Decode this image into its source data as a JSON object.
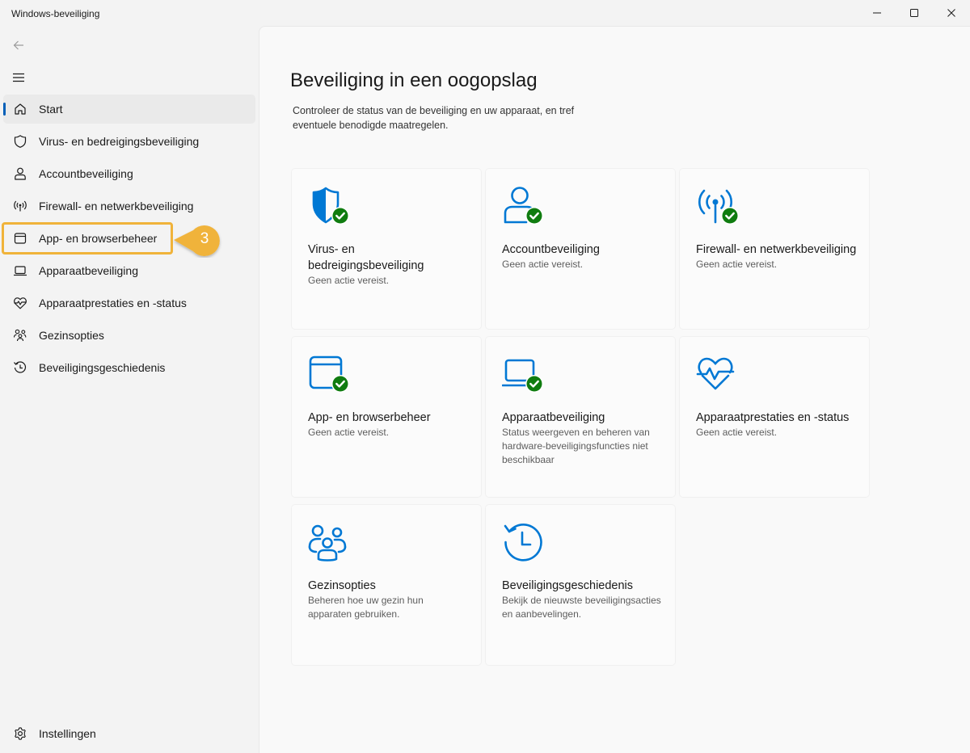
{
  "window": {
    "title": "Windows-beveiliging"
  },
  "nav": {
    "items": [
      {
        "label": "Start",
        "icon": "home-icon"
      },
      {
        "label": "Virus- en bedreigingsbeveiliging",
        "icon": "shield-icon"
      },
      {
        "label": "Accountbeveiliging",
        "icon": "person-icon"
      },
      {
        "label": "Firewall- en netwerkbeveiliging",
        "icon": "antenna-icon"
      },
      {
        "label": "App- en browserbeheer",
        "icon": "browser-window-icon"
      },
      {
        "label": "Apparaatbeveiliging",
        "icon": "laptop-icon"
      },
      {
        "label": "Apparaatprestaties en -status",
        "icon": "heart-pulse-icon"
      },
      {
        "label": "Gezinsopties",
        "icon": "family-icon"
      },
      {
        "label": "Beveiligingsgeschiedenis",
        "icon": "history-icon"
      }
    ],
    "active_index": 0,
    "settings_label": "Instellingen"
  },
  "callout": {
    "number": "3",
    "color": "#f0b33a"
  },
  "main": {
    "title": "Beveiliging in een oogopslag",
    "description": "Controleer de status van de beveiliging en uw apparaat, en tref eventuele benodigde maatregelen.",
    "tiles": [
      {
        "title": "Virus- en bedreigingsbeveiliging",
        "status": "Geen actie vereist."
      },
      {
        "title": "Accountbeveiliging",
        "status": "Geen actie vereist."
      },
      {
        "title": "Firewall- en netwerkbeveiliging",
        "status": "Geen actie vereist."
      },
      {
        "title": "App- en browserbeheer",
        "status": "Geen actie vereist."
      },
      {
        "title": "Apparaatbeveiliging",
        "status": "Status weergeven en beheren van hardware-beveiligingsfuncties niet beschikbaar"
      },
      {
        "title": "Apparaatprestaties en -status",
        "status": "Geen actie vereist."
      },
      {
        "title": "Gezinsopties",
        "status": "Beheren hoe uw gezin hun apparaten gebruiken."
      },
      {
        "title": "Beveiligingsgeschiedenis",
        "status": "Bekijk de nieuwste beveiligingsacties en aanbevelingen."
      }
    ]
  },
  "colors": {
    "accent": "#005fb8",
    "icon_blue": "#0078d4",
    "ok_green": "#107c10"
  }
}
